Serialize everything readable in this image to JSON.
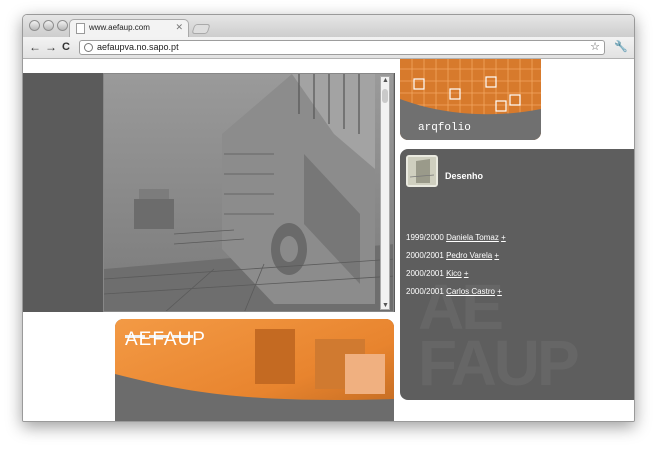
{
  "browser": {
    "tab_title": "www.aefaup.com",
    "tab_close": "✕",
    "url": "aefaupva.no.sapo.pt",
    "back": "←",
    "forward": "→",
    "reload": "C",
    "star": "☆",
    "wrench": "🔧"
  },
  "page": {
    "banner_title": "AEFAUP",
    "arqfolio_label": "arqfolio",
    "desenho_title": "Desenho",
    "entries": [
      {
        "year": "1999/2000",
        "name": "Daniela Tomaz",
        "more": "+"
      },
      {
        "year": "2000/2001",
        "name": "Pedro Varela",
        "more": "+"
      },
      {
        "year": "2000/2001",
        "name": "Kico",
        "more": "+"
      },
      {
        "year": "2000/2001",
        "name": "Carlos Castro",
        "more": "+"
      }
    ],
    "watermark": "AE FAUP"
  },
  "colors": {
    "panel_gray": "#5b5b5b",
    "accent_orange": "#e8842e"
  }
}
